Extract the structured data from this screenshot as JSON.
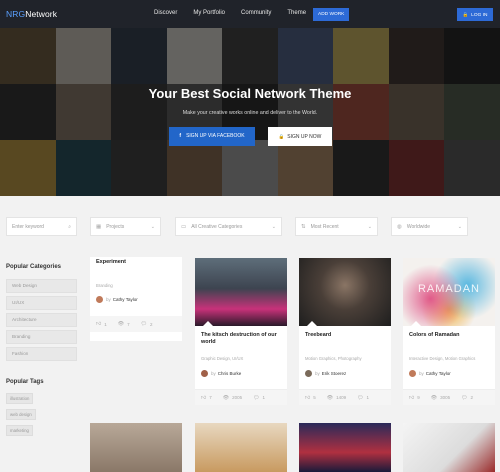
{
  "nav": {
    "logo_prefix": "NRG",
    "logo_main": "Network",
    "links": [
      "Discover",
      "My Portfolio",
      "Community",
      "Theme"
    ],
    "add_work": "ADD WORK",
    "login": "LOG IN"
  },
  "hero": {
    "title": "Your Best Social Network Theme",
    "subtitle": "Make your creative works online and deliver to the World.",
    "facebook_button": "SIGN UP VIA FACEBOOK",
    "signup_button": "SIGN UP NOW"
  },
  "filters": {
    "keyword_placeholder": "Enter keyword",
    "projects": "Projects",
    "categories": "All Creative Categories",
    "sort": "Most Recent",
    "region": "Worldwide"
  },
  "sidebar": {
    "categories_heading": "Popular Categories",
    "categories": [
      "Web Design",
      "UI/UX",
      "Architecture",
      "Branding",
      "Fashion"
    ],
    "tags_heading": "Popular Tags",
    "tags": [
      "illustration",
      "web design",
      "marketing"
    ]
  },
  "experiment_card": {
    "title": "Experiment",
    "category": "Branding",
    "author_prefix": "",
    "author": "Cathy Taylor",
    "likes": "1",
    "views": "7",
    "comments": "2"
  },
  "cards": [
    {
      "title": "The kitsch destruction of our world",
      "category": "Graphic Design, UI/UX",
      "author": "Chris Burke",
      "likes": "7",
      "views": "2005",
      "comments": "1"
    },
    {
      "title": "Treebeard",
      "category": "Motion Graphics, Photography",
      "author": "Erik Stoerez",
      "likes": "5",
      "views": "1409",
      "comments": "1"
    },
    {
      "title": "Colors of Ramadan",
      "category": "Interactive Design, Motion Graphics",
      "author": "Cathy Taylor",
      "likes": "9",
      "views": "3005",
      "comments": "2"
    }
  ],
  "by_label": "by",
  "ramadan_overlay": "RAMADAN",
  "colors": {
    "accent": "#2d6ad6",
    "nav_bg": "#20232a",
    "facebook": "#2266c9"
  },
  "icons": {
    "search": "search-icon",
    "grid": "grid-icon",
    "folder": "folder-icon",
    "sort": "sort-icon",
    "globe": "globe-icon",
    "lock": "lock-icon",
    "thumbs_up": "thumbs-up-icon",
    "eye": "eye-icon",
    "comment": "comment-icon"
  }
}
